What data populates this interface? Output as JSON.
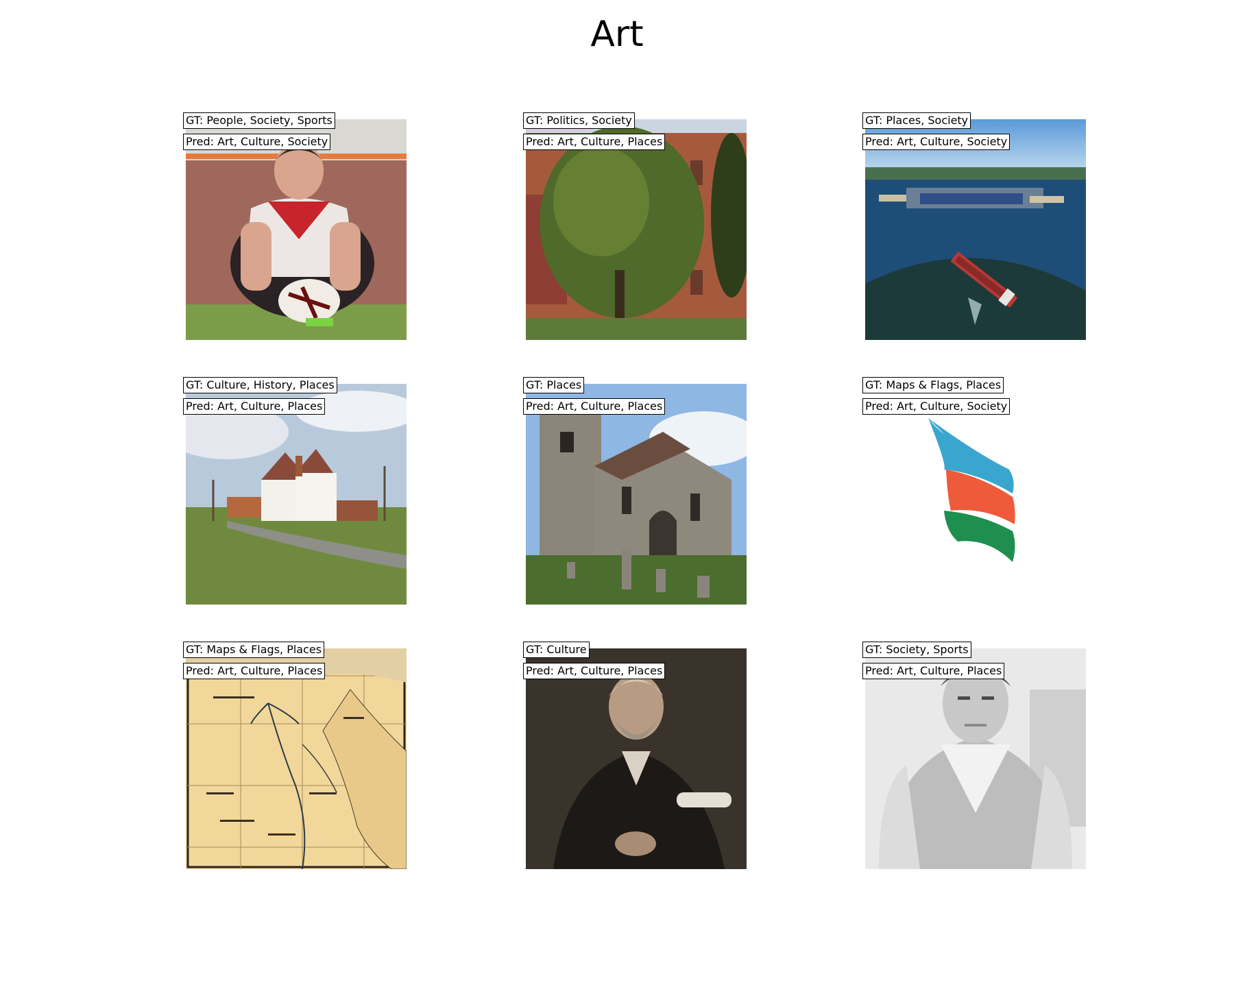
{
  "title": "Art",
  "panels": [
    {
      "gt_prefix": "GT:",
      "gt": "People, Society, Sports",
      "pred_prefix": "Pred:",
      "pred": "Art, Culture, Society",
      "image": "rugby-player-photo"
    },
    {
      "gt_prefix": "GT:",
      "gt": "Politics, Society",
      "pred_prefix": "Pred:",
      "pred": "Art, Culture, Places",
      "image": "brick-building-with-tree-photo"
    },
    {
      "gt_prefix": "GT:",
      "gt": "Places, Society",
      "pred_prefix": "Pred:",
      "pred": "Art, Culture, Society",
      "image": "aerial-port-and-ship-photo"
    },
    {
      "gt_prefix": "GT:",
      "gt": "Culture, History, Places",
      "pred_prefix": "Pred:",
      "pred": "Art, Culture, Places",
      "image": "village-white-house-photo"
    },
    {
      "gt_prefix": "GT:",
      "gt": "Places",
      "pred_prefix": "Pred:",
      "pred": "Art, Culture, Places",
      "image": "stone-church-graveyard-photo"
    },
    {
      "gt_prefix": "GT:",
      "gt": "Maps & Flags, Places",
      "pred_prefix": "Pred:",
      "pred": "Art, Culture, Society",
      "image": "flame-logo-blue-orange-green"
    },
    {
      "gt_prefix": "GT:",
      "gt": "Maps & Flags, Places",
      "pred_prefix": "Pred:",
      "pred": "Art, Culture, Places",
      "image": "old-egypt-map"
    },
    {
      "gt_prefix": "GT:",
      "gt": "Culture",
      "pred_prefix": "Pred:",
      "pred": "Art, Culture, Places",
      "image": "bearded-man-sepia-portrait"
    },
    {
      "gt_prefix": "GT:",
      "gt": "Society, Sports",
      "pred_prefix": "Pred:",
      "pred": "Art, Culture, Places",
      "image": "man-in-sweater-bw-photo"
    }
  ],
  "colors": {
    "flame_blue": "#3aa6cf",
    "flame_orange": "#ef5a3a",
    "flame_green": "#1e8f4e",
    "map_paper": "#f2d79a"
  }
}
